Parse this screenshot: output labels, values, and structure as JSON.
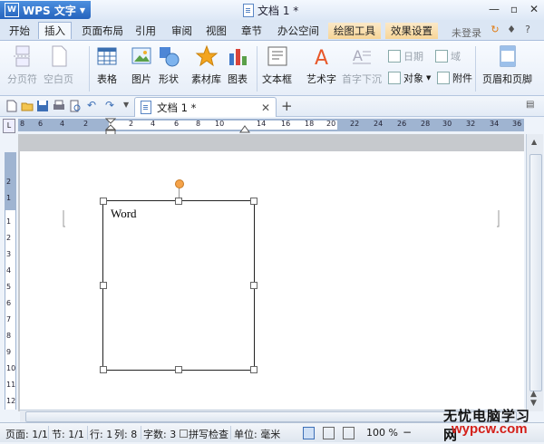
{
  "titlebar": {
    "app_name": "WPS 文字",
    "doc_title": "文档 1 *"
  },
  "menu": {
    "tabs": [
      "开始",
      "插入",
      "页面布局",
      "引用",
      "审阅",
      "视图",
      "章节",
      "办公空间",
      "绘图工具",
      "效果设置"
    ],
    "active": "插入",
    "login": "未登录"
  },
  "ribbon": {
    "page_break": "分页符",
    "blank_page": "空白页",
    "table": "表格",
    "picture": "图片",
    "shape": "形状",
    "clipart": "素材库",
    "chart": "图表",
    "textbox": "文本框",
    "wordart": "艺术字",
    "dropcap": "首字下沉",
    "date": "日期",
    "field": "域",
    "object": "对象",
    "attachment": "附件",
    "header_footer": "页眉和页脚"
  },
  "doctab": {
    "title": "文档 1 *"
  },
  "ruler": {
    "h_ticks": [
      "8",
      "6",
      "4",
      "2",
      "2",
      "4",
      "6",
      "8",
      "10",
      "14",
      "16",
      "18",
      "20",
      "22",
      "24",
      "26",
      "28",
      "30",
      "32",
      "34",
      "36",
      "38"
    ],
    "v_ticks": [
      "2",
      "1",
      "1",
      "2",
      "3",
      "4",
      "5",
      "6",
      "7",
      "8",
      "9",
      "10",
      "11",
      "12"
    ]
  },
  "document": {
    "textbox_text": "Word"
  },
  "status": {
    "page": "页面: 1/1",
    "section": "节: 1/1",
    "row": "行: 1",
    "col": "列: 8",
    "wordcount": "字数: 3",
    "spellcheck": "拼写检查",
    "unit": "单位: 毫米",
    "zoom": "100 %"
  },
  "watermark": {
    "line1": "无忧电脑学习网",
    "line2": "wypcw.com"
  }
}
